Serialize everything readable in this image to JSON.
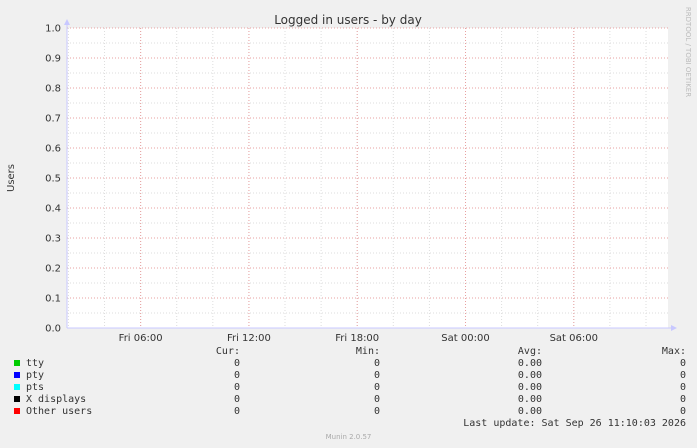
{
  "chart_data": {
    "type": "area",
    "title": "Logged in users - by day",
    "ylabel": "Users",
    "xlabel": "",
    "ylim": [
      0,
      1.0
    ],
    "yticks": [
      "0.0",
      "0.1",
      "0.2",
      "0.3",
      "0.4",
      "0.5",
      "0.6",
      "0.7",
      "0.8",
      "0.9",
      "1.0"
    ],
    "xticks": [
      "Fri 06:00",
      "Fri 12:00",
      "Fri 18:00",
      "Sat 00:00",
      "Sat 06:00"
    ],
    "grid": true,
    "watermark": "RRDTOOL / TOBI OETIKER",
    "series": [
      {
        "name": "tty",
        "color": "#00cc00",
        "values": [
          0
        ]
      },
      {
        "name": "pty",
        "color": "#0066b3",
        "values": [
          0
        ]
      },
      {
        "name": "pts",
        "color": "#00ffff",
        "values": [
          0
        ]
      },
      {
        "name": "X displays",
        "color": "#000000",
        "values": [
          0
        ]
      },
      {
        "name": "Other users",
        "color": "#ff0000",
        "values": [
          0
        ]
      }
    ]
  },
  "legend": {
    "headers": {
      "cur": "Cur:",
      "min": "Min:",
      "avg": "Avg:",
      "max": "Max:"
    },
    "rows": [
      {
        "name": "tty",
        "color": "#00cc00",
        "cur": "0",
        "min": "0",
        "avg": "0.00",
        "max": "0"
      },
      {
        "name": "pty",
        "color": "#0000ff",
        "cur": "0",
        "min": "0",
        "avg": "0.00",
        "max": "0"
      },
      {
        "name": "pts",
        "color": "#00ffff",
        "cur": "0",
        "min": "0",
        "avg": "0.00",
        "max": "0"
      },
      {
        "name": "X displays",
        "color": "#000000",
        "cur": "0",
        "min": "0",
        "avg": "0.00",
        "max": "0"
      },
      {
        "name": "Other users",
        "color": "#ff0000",
        "cur": "0",
        "min": "0",
        "avg": "0.00",
        "max": "0"
      }
    ]
  },
  "footer": {
    "last_update": "Last update: Sat Sep 26 11:10:03 2026",
    "munin": "Munin 2.0.57"
  }
}
